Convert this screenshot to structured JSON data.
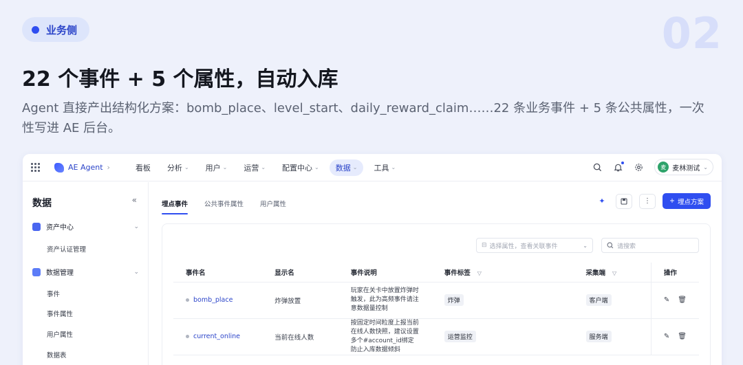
{
  "slide": {
    "tag": "业务侧",
    "number": "02",
    "headline": "22 个事件 + 5 个属性，自动入库",
    "subline": "Agent 直接产出结构化方案：bomb_place、level_start、daily_reward_claim……22 条业务事件 + 5 条公共属性，一次性写进 AE 后台。",
    "colors": {
      "accent": "#2f4ef0",
      "background": "#eef1fb",
      "number": "#d7defa"
    }
  },
  "topbar": {
    "brand": "AE Agent",
    "nav": [
      {
        "label": "看板",
        "has_menu": false,
        "active": false
      },
      {
        "label": "分析",
        "has_menu": true,
        "active": false
      },
      {
        "label": "用户",
        "has_menu": true,
        "active": false
      },
      {
        "label": "运营",
        "has_menu": true,
        "active": false
      },
      {
        "label": "配置中心",
        "has_menu": true,
        "active": false
      },
      {
        "label": "数据",
        "has_menu": true,
        "active": true
      },
      {
        "label": "工具",
        "has_menu": true,
        "active": false
      }
    ],
    "user": {
      "avatar": "麦",
      "name": "麦林测试"
    },
    "icons": [
      "search-icon",
      "bell-icon",
      "gear-icon"
    ]
  },
  "sidebar": {
    "title": "数据",
    "groups": [
      {
        "label": "资产中心",
        "items": [
          "资产认证管理"
        ]
      },
      {
        "label": "数据管理",
        "items": [
          "事件",
          "事件属性",
          "用户属性",
          "数据表"
        ]
      }
    ]
  },
  "main": {
    "tabs": [
      "埋点事件",
      "公共事件属性",
      "用户属性"
    ],
    "active_tab": 0,
    "primary_button": "埋点方案",
    "filter_placeholder": "选择属性，查看关联事件",
    "search_placeholder": "请搜索",
    "table": {
      "columns": [
        "事件名",
        "显示名",
        "事件说明",
        "事件标签",
        "采集端",
        "操作"
      ],
      "rows": [
        {
          "name": "bomb_place",
          "display": "炸弹放置",
          "desc": "玩家在关卡中放置炸弹时触发，此为高频事件请注意数据量控制",
          "tag": "炸弹",
          "client": "客户端"
        },
        {
          "name": "current_online",
          "display": "当前在线人数",
          "desc": "按固定时间粒度上报当前在线人数快照，建议设置多个#account_id绑定防止入库数据倾斜",
          "tag": "运营监控",
          "client": "服务端"
        }
      ]
    }
  }
}
